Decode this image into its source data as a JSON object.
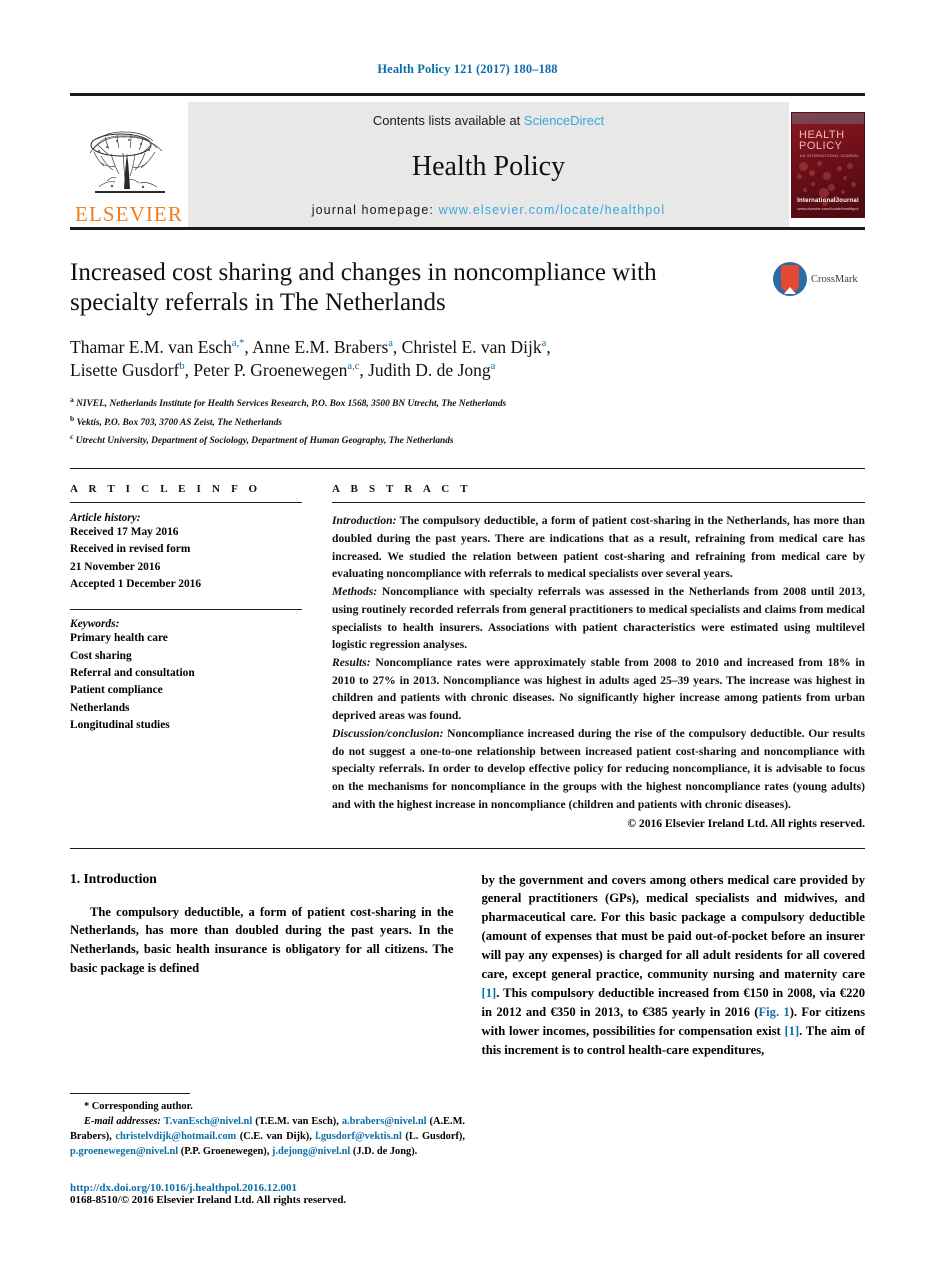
{
  "running_head": "Health Policy 121 (2017) 180–188",
  "masthead": {
    "publisher": "ELSEVIER",
    "contents_prefix": "Contents lists available at ",
    "contents_link": "ScienceDirect",
    "journal_title": "Health Policy",
    "homepage_prefix": "journal homepage: ",
    "homepage_url": "www.elsevier.com/locate/healthpol",
    "cover_title_line1": "HEALTH",
    "cover_title_line2": "POLICY",
    "cover_subtitle": "AN INTERNATIONAL JOURNAL",
    "cover_footer_logo": "InternationalJournal",
    "cover_footer_line": "www.elsevier.com/locate/healthpol"
  },
  "article": {
    "title": "Increased cost sharing and changes in noncompliance with specialty referrals in The Netherlands",
    "crossmark_label": "CrossMark",
    "authors_line1_parts": [
      {
        "name": "Thamar E.M. van Esch",
        "sup": "a,*"
      },
      {
        "name": "Anne E.M. Brabers",
        "sup": "a"
      },
      {
        "name": "Christel E. van Dijk",
        "sup": "a"
      }
    ],
    "authors_line2_parts": [
      {
        "name": "Lisette Gusdorf",
        "sup": "b"
      },
      {
        "name": "Peter P. Groenewegen",
        "sup": "a,c"
      },
      {
        "name": "Judith D. de Jong",
        "sup": "a"
      }
    ],
    "affiliations": [
      {
        "marker": "a",
        "text": "NIVEL, Netherlands Institute for Health Services Research, P.O. Box 1568, 3500 BN Utrecht, The Netherlands"
      },
      {
        "marker": "b",
        "text": "Vektis, P.O. Box 703, 3700 AS Zeist, The Netherlands"
      },
      {
        "marker": "c",
        "text": "Utrecht University, Department of Sociology, Department of Human Geography, The Netherlands"
      }
    ]
  },
  "article_info": {
    "heading": "A R T I C L E   I N F O",
    "history_label": "Article history:",
    "history": [
      "Received 17 May 2016",
      "Received in revised form",
      "21 November 2016",
      "Accepted 1 December 2016"
    ],
    "keywords_label": "Keywords:",
    "keywords": [
      "Primary health care",
      "Cost sharing",
      "Referral and consultation",
      "Patient compliance",
      "Netherlands",
      "Longitudinal studies"
    ]
  },
  "abstract": {
    "heading": "A B S T R A C T",
    "sections": [
      {
        "label": "Introduction:",
        "text": " The compulsory deductible, a form of patient cost-sharing in the Netherlands, has more than doubled during the past years. There are indications that as a result, refraining from medical care has increased. We studied the relation between patient cost-sharing and refraining from medical care by evaluating noncompliance with referrals to medical specialists over several years."
      },
      {
        "label": "Methods:",
        "text": " Noncompliance with specialty referrals was assessed in the Netherlands from 2008 until 2013, using routinely recorded referrals from general practitioners to medical specialists and claims from medical specialists to health insurers. Associations with patient characteristics were estimated using multilevel logistic regression analyses."
      },
      {
        "label": "Results:",
        "text": " Noncompliance rates were approximately stable from 2008 to 2010 and increased from 18% in 2010 to 27% in 2013. Noncompliance was highest in adults aged 25–39 years. The increase was highest in children and patients with chronic diseases. No significantly higher increase among patients from urban deprived areas was found."
      },
      {
        "label": "Discussion/conclusion:",
        "text": " Noncompliance increased during the rise of the compulsory deductible. Our results do not suggest a one-to-one relationship between increased patient cost-sharing and noncompliance with specialty referrals. In order to develop effective policy for reducing noncompliance, it is advisable to focus on the mechanisms for noncompliance in the groups with the highest noncompliance rates (young adults) and with the highest increase in noncompliance (children and patients with chronic diseases)."
      }
    ],
    "copyright": "© 2016 Elsevier Ireland Ltd. All rights reserved."
  },
  "body": {
    "section_heading": "1.  Introduction",
    "left_paragraph": "The compulsory deductible, a form of patient cost-sharing in the Netherlands, has more than doubled during the past years. In the Netherlands, basic health insurance is obligatory for all citizens. The basic package is defined",
    "right_paragraph_part1": "by the government and covers among others medical care provided by general practitioners (GPs), medical specialists and midwives, and pharmaceutical care. For this basic package a compulsory deductible (amount of expenses that must be paid out-of-pocket before an insurer will pay any expenses) is charged for all adult residents for all covered care, except general practice, community nursing and maternity care ",
    "ref1": "[1]",
    "right_paragraph_part2": ". This compulsory deductible increased from €150 in 2008, via €220 in 2012 and €350 in 2013, to €385 yearly in 2016 (",
    "figref": "Fig. 1",
    "right_paragraph_part3": "). For citizens with lower incomes, possibilities for compensation exist ",
    "ref2": "[1]",
    "right_paragraph_part4": ". The aim of this increment is to control health-care expenditures,"
  },
  "footnotes": {
    "corresponding": "* Corresponding author.",
    "email_label": "E-mail addresses:",
    "emails": [
      {
        "address": "T.vanEsch@nivel.nl",
        "owner": "(T.E.M. van Esch)"
      },
      {
        "address": "a.brabers@nivel.nl",
        "owner": "(A.E.M. Brabers)"
      },
      {
        "address": "christelvdijk@hotmail.com",
        "owner": "(C.E. van Dijk)"
      },
      {
        "address": "l.gusdorf@vektis.nl",
        "owner": "(L. Gusdorf)"
      },
      {
        "address": "p.groenewegen@nivel.nl",
        "owner": "(P.P. Groenewegen)"
      },
      {
        "address": "j.dejong@nivel.nl",
        "owner": "(J.D. de Jong)"
      }
    ],
    "doi": "http://dx.doi.org/10.1016/j.healthpol.2016.12.001",
    "issn": "0168-8510/© 2016 Elsevier Ireland Ltd. All rights reserved."
  },
  "colors": {
    "link_blue": "#0b6ea8",
    "sciencedirect_blue": "#3aa6d8",
    "elsevier_orange": "#f07d1a",
    "banner_gray": "#e8e8e8",
    "cover_red": "#8f1720"
  }
}
